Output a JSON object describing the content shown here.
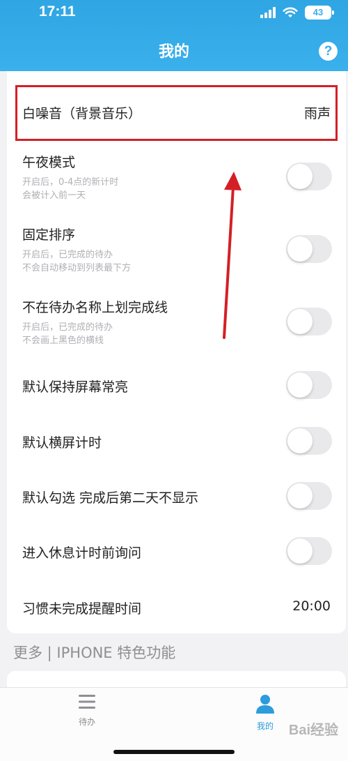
{
  "status_bar": {
    "time": "17:11",
    "battery": "43"
  },
  "header": {
    "title": "我的",
    "help_icon": "?"
  },
  "settings": {
    "white_noise": {
      "label": "白噪音（背景音乐）",
      "value": "雨声"
    },
    "midnight_mode": {
      "label": "午夜模式",
      "desc_line1": "开启后，0-4点的新计时",
      "desc_line2": "会被计入前一天",
      "enabled": false
    },
    "fixed_sort": {
      "label": "固定排序",
      "desc_line1": "开启后，已完成的待办",
      "desc_line2": "不会自动移动到列表最下方",
      "enabled": false
    },
    "no_strikethrough": {
      "label": "不在待办名称上划完成线",
      "desc_line1": "开启后，已完成的待办",
      "desc_line2": "不会画上黑色的横线",
      "enabled": false
    },
    "keep_screen_on": {
      "label": "默认保持屏幕常亮",
      "enabled": false
    },
    "landscape_timer": {
      "label": "默认横屏计时",
      "enabled": false
    },
    "hide_next_day": {
      "label": "默认勾选 完成后第二天不显示",
      "enabled": false
    },
    "ask_before_rest": {
      "label": "进入休息计时前询问",
      "enabled": false
    },
    "habit_reminder": {
      "label": "习惯未完成提醒时间",
      "value": "20:00"
    }
  },
  "section": {
    "more_label": "更多 | IPHONE 特色功能"
  },
  "tabbar": {
    "todo": {
      "label": "待办",
      "icon": "menu-icon"
    },
    "mine": {
      "label": "我的",
      "icon": "user-icon",
      "active": true
    }
  },
  "colors": {
    "accent": "#3ab0ec",
    "highlight": "#d41f27"
  }
}
